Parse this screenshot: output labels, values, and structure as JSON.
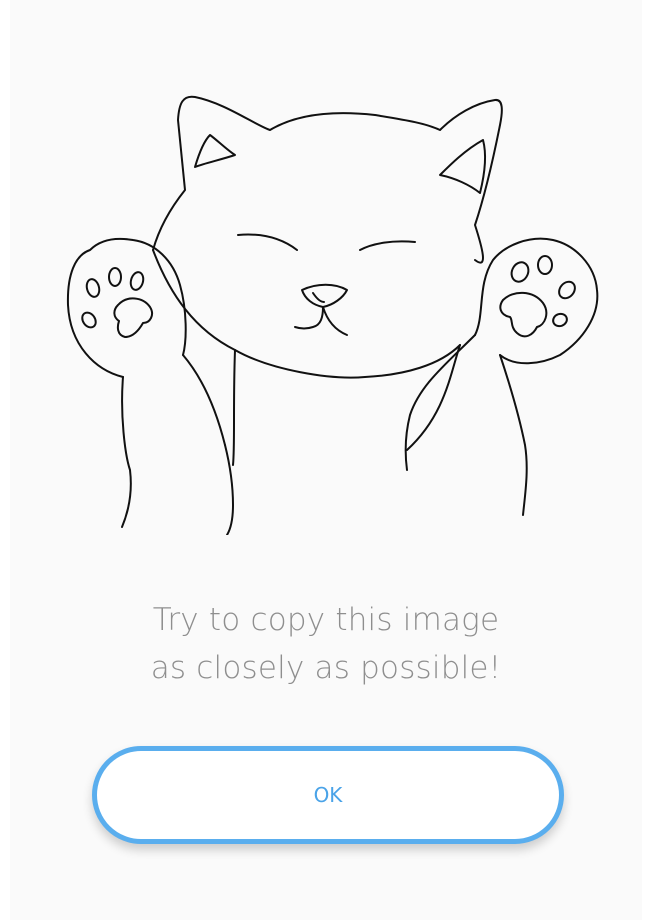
{
  "illustration": {
    "icon": "cat-line-drawing",
    "stroke_color": "#111111"
  },
  "instruction": {
    "line1": "Try to copy this image",
    "line2": "as closely as possible!"
  },
  "ok_button": {
    "label": "OK",
    "border_color": "#5aaeee",
    "text_color": "#4aa3e8"
  }
}
